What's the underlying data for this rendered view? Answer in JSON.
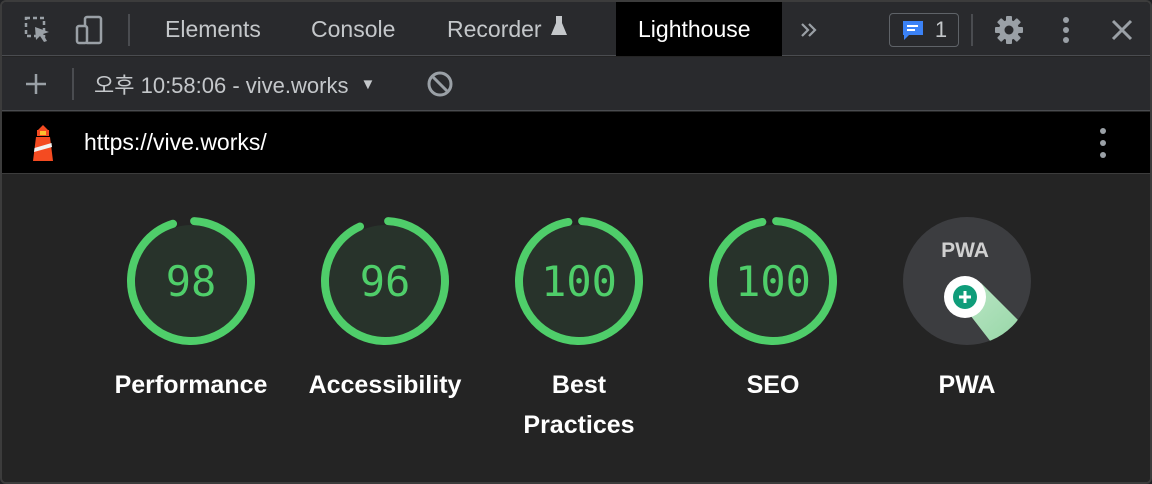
{
  "devtools": {
    "tabs": [
      "Elements",
      "Console",
      "Recorder",
      "Lighthouse"
    ],
    "active_tab": "Lighthouse",
    "more_tabs_icon": "double-chevron-right-icon",
    "issues_count": "1",
    "colors": {
      "toolbar_bg": "#292a2d",
      "active_tab_bg": "#000000",
      "issues_icon": "#3b82f6"
    }
  },
  "toolbar": {
    "report_label": "오후 10:58:06 - vive.works",
    "icons": [
      "plus-icon",
      "caret-down-icon",
      "clear-icon"
    ]
  },
  "urlbar": {
    "url": "https://vive.works/",
    "icons": [
      "lighthouse-logo-icon",
      "kebab-menu-icon"
    ]
  },
  "categories": [
    {
      "label": "Performance",
      "score": "98",
      "fraction": 0.98
    },
    {
      "label": "Accessibility",
      "score": "96",
      "fraction": 0.96
    },
    {
      "label": "Best\nPractices",
      "score": "100",
      "fraction": 1.0
    },
    {
      "label": "SEO",
      "score": "100",
      "fraction": 1.0
    }
  ],
  "pwa": {
    "label": "PWA",
    "badge_text": "PWA"
  },
  "colors": {
    "pass_green": "#4fce6a",
    "gauge_fill": "#28332b",
    "pwa_bg": "#3c3d40"
  }
}
